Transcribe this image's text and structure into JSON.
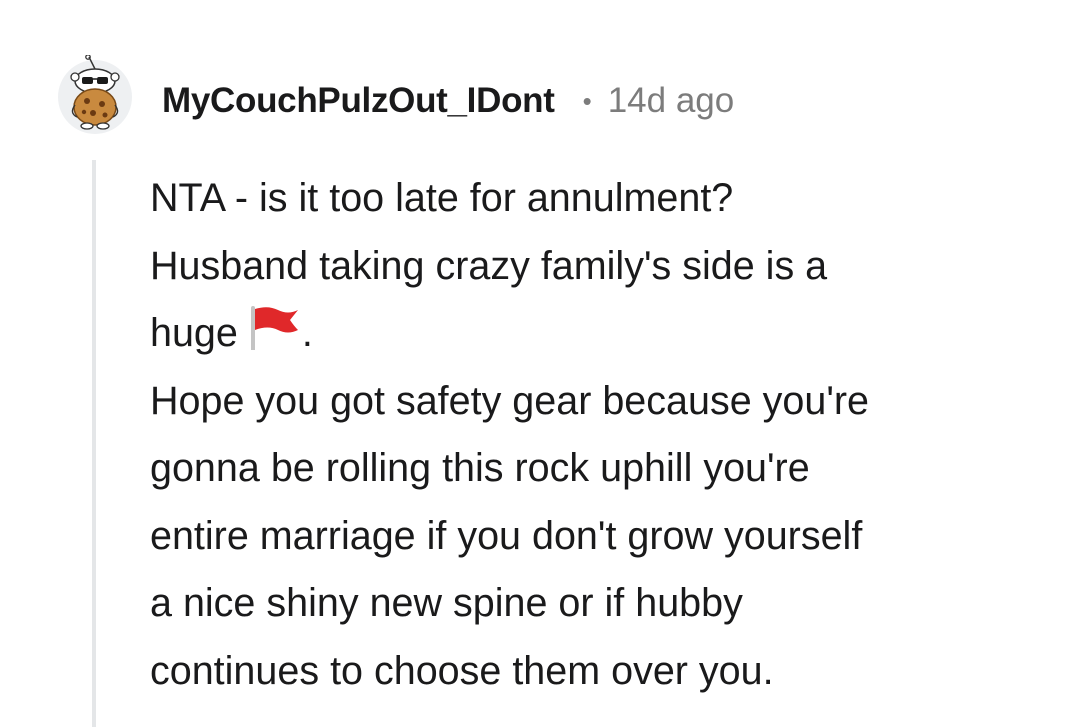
{
  "comment": {
    "username": "MyCouchPulzOut_IDont",
    "separator": "•",
    "timestamp": "14d ago",
    "lines": [
      "NTA - is it too late for annulment?",
      "Husband taking crazy family's side is a",
      "huge",
      ".",
      "Hope you got safety gear because you're",
      "gonna be rolling this rock uphill you're",
      "entire marriage if you don't grow yourself",
      "a nice shiny new spine or if hubby",
      "continues to choose them over you."
    ],
    "emoji": "red-flag-icon",
    "avatar": "snoo-avatar-icon"
  },
  "colors": {
    "text": "#1a1a1b",
    "muted": "#7c7c7c",
    "thread_line": "#e4e6e8",
    "flag_red": "#e0282a"
  }
}
